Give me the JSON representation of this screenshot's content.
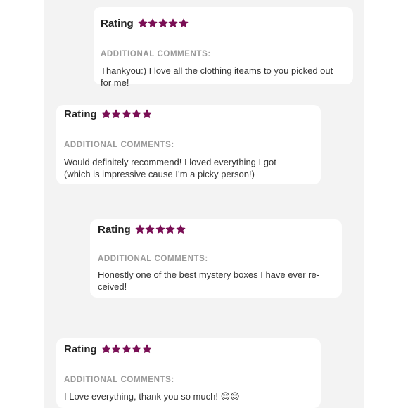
{
  "colors": {
    "star": "#7a0f55",
    "background": "#f3f3f3",
    "card": "#ffffff"
  },
  "reviews": [
    {
      "rating_label": "Rating",
      "stars": 5,
      "comments_label": "ADDITIONAL COMMENTS:",
      "comment_line1": "Thankyou:) I love all the clothing iteams to you picked out",
      "comment_line2": "for me!"
    },
    {
      "rating_label": "Rating",
      "stars": 5,
      "comments_label": "ADDITIONAL COMMENTS:",
      "comment_line1": "Would definitely recommend! I loved everything I got",
      "comment_line2": "(which is impressive cause I’m a picky person!)"
    },
    {
      "rating_label": "Rating",
      "stars": 5,
      "comments_label": "ADDITIONAL COMMENTS:",
      "comment_line1": "Honestly one of the best mystery boxes I have ever re-",
      "comment_line2": "ceived!"
    },
    {
      "rating_label": "Rating",
      "stars": 5,
      "comments_label": "ADDITIONAL COMMENTS:",
      "comment_line1": "I Love everything, thank you so much! 😊😊",
      "comment_line2": ""
    }
  ]
}
